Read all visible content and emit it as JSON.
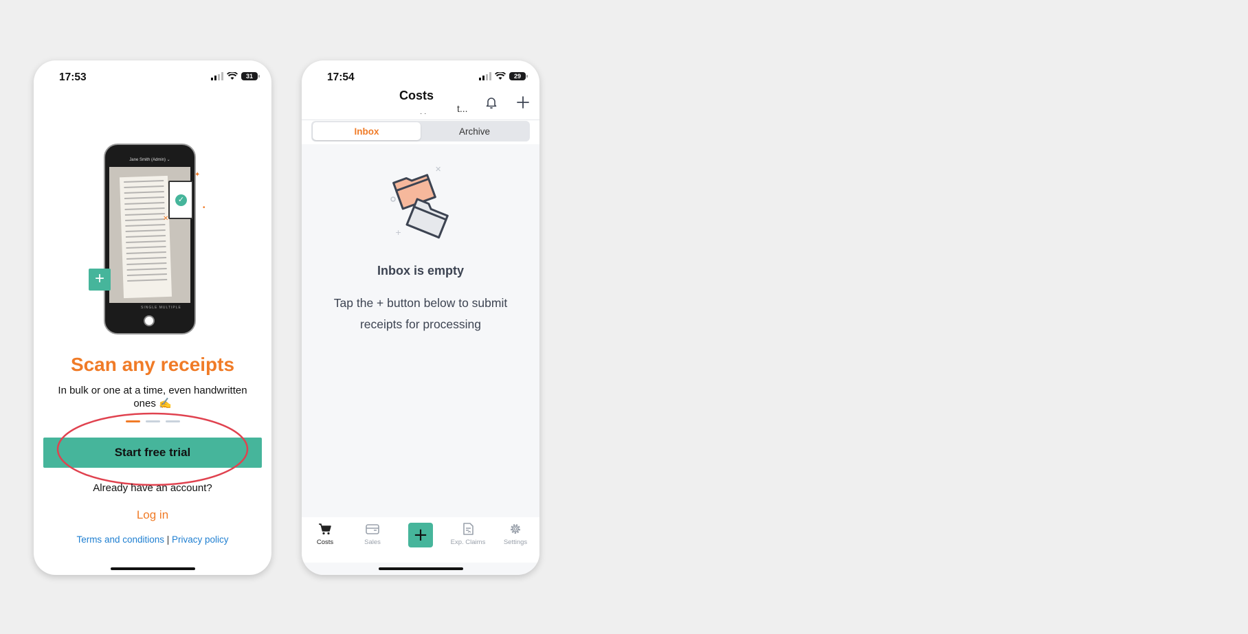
{
  "onboarding": {
    "status": {
      "time": "17:53",
      "battery": "31"
    },
    "illustration": {
      "mini_top": "Jane Smith (Admin) ⌄",
      "mini_modes": "SINGLE MULTIPLE",
      "float_plus": "+",
      "check": "✓"
    },
    "headline": "Scan any receipts",
    "subline": "In bulk or one at a time, even handwritten ones ✍️",
    "cta_label": "Start free trial",
    "already_label": "Already have an account?",
    "login_label": "Log in",
    "terms_label": "Terms and conditions",
    "separator": " | ",
    "privacy_label": "Privacy policy",
    "accent_color": "#f07b27",
    "brand_green": "#46b59b",
    "annotation_color": "#e0424f"
  },
  "costs": {
    "status": {
      "time": "17:54",
      "battery": "29"
    },
    "title": "Costs",
    "subtitle": "t...",
    "subtitle_dots": "· ·",
    "tabs": [
      {
        "label": "Inbox",
        "active": true
      },
      {
        "label": "Archive",
        "active": false
      }
    ],
    "empty_title": "Inbox is empty",
    "empty_desc": "Tap the + button below to submit receipts for processing",
    "fab_label": "+",
    "nav": [
      {
        "label": "Costs",
        "icon": "cart-icon",
        "active": true
      },
      {
        "label": "Sales",
        "icon": "wallet-icon",
        "active": false
      },
      {
        "label": "Exp. Claims",
        "icon": "document-icon",
        "active": false
      },
      {
        "label": "Settings",
        "icon": "gear-icon",
        "active": false
      }
    ]
  }
}
